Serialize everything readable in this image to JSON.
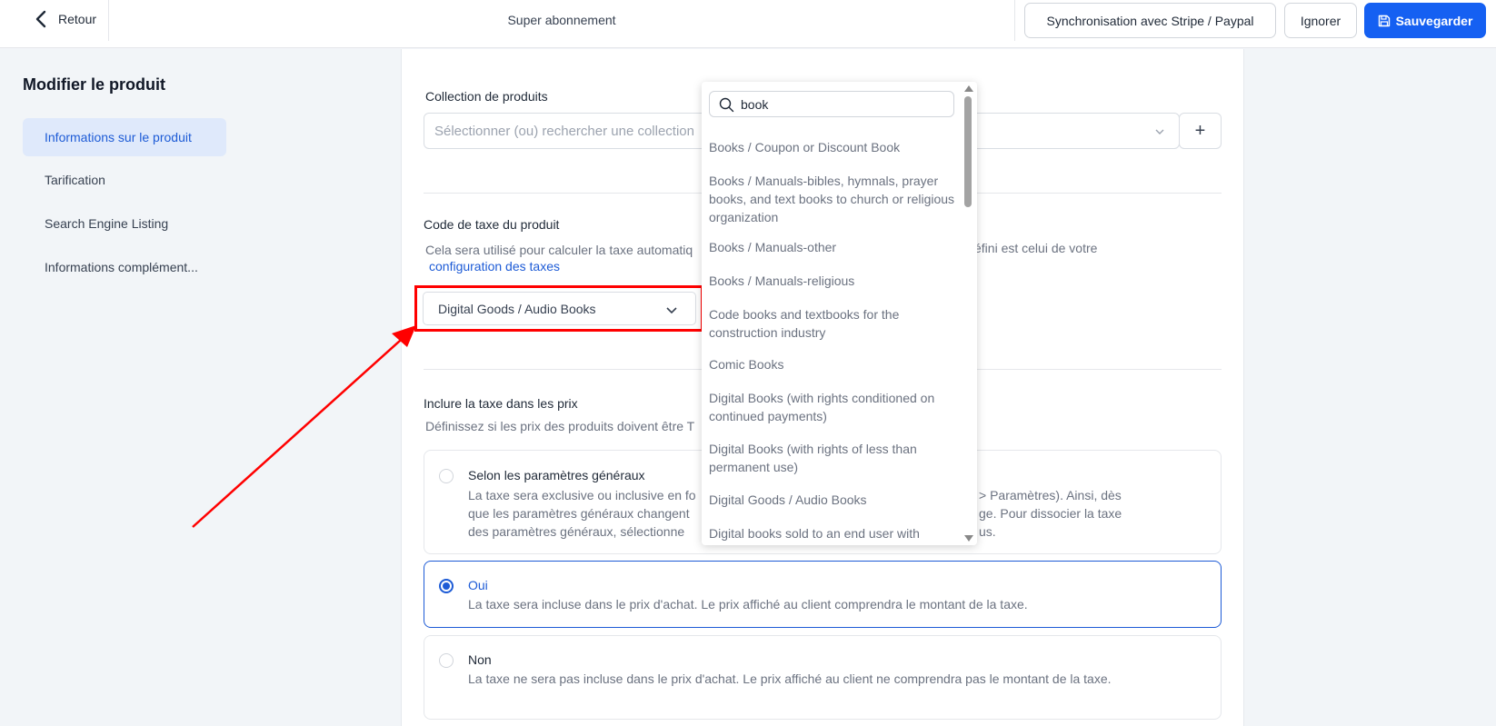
{
  "header": {
    "back_label": "Retour",
    "title": "Super abonnement",
    "sync_label": "Synchronisation avec Stripe / Paypal",
    "ignore_label": "Ignorer",
    "save_label": "Sauvegarder"
  },
  "sidebar": {
    "title": "Modifier le produit",
    "items": [
      {
        "label": "Informations sur le produit"
      },
      {
        "label": "Tarification"
      },
      {
        "label": "Search Engine Listing"
      },
      {
        "label": "Informations complément..."
      }
    ]
  },
  "collection": {
    "label": "Collection de produits",
    "placeholder": "Sélectionner (ou) rechercher une collection",
    "add_label": "+"
  },
  "tax_code": {
    "label": "Code de taxe du produit",
    "description": "Cela sera utilisé pour calculer la taxe automatiq",
    "description_end": "éfini est celui de votre",
    "link": "configuration des taxes",
    "selected": "Digital Goods / Audio Books"
  },
  "dropdown": {
    "search_value": "book",
    "options": [
      "Books / Coupon or Discount Book",
      "Books / Manuals-bibles, hymnals, prayer books, and text books to church or religious organization",
      "Books / Manuals-other",
      "Books / Manuals-religious",
      "Code books and textbooks for the construction industry",
      "Comic Books",
      "Digital Books (with rights conditioned on continued payments)",
      "Digital Books (with rights of less than permanent use)",
      "Digital Goods / Audio Books",
      "Digital books sold to an end user with"
    ]
  },
  "include_tax": {
    "label": "Inclure la taxe dans les prix",
    "description": "Définissez si les prix des produits doivent être T",
    "options": [
      {
        "title": "Selon les paramètres généraux",
        "text_line1": "La taxe sera exclusive ou inclusive en fo",
        "text_line1_end": "> Paramètres). Ainsi, dès",
        "text_line2": "que les paramètres généraux changent",
        "text_line2_end": "ge. Pour dissocier la taxe",
        "text_line3": "des paramètres généraux, sélectionne",
        "text_line3_end": "us."
      },
      {
        "title": "Oui",
        "text": "La taxe sera incluse dans le prix d'achat. Le prix affiché au client comprendra le montant de la taxe."
      },
      {
        "title": "Non",
        "text": "La taxe ne sera pas incluse dans le prix d'achat. Le prix affiché au client ne comprendra pas le montant de la taxe."
      }
    ]
  },
  "colors": {
    "primary": "#1560f2",
    "highlight": "#ff0000"
  }
}
